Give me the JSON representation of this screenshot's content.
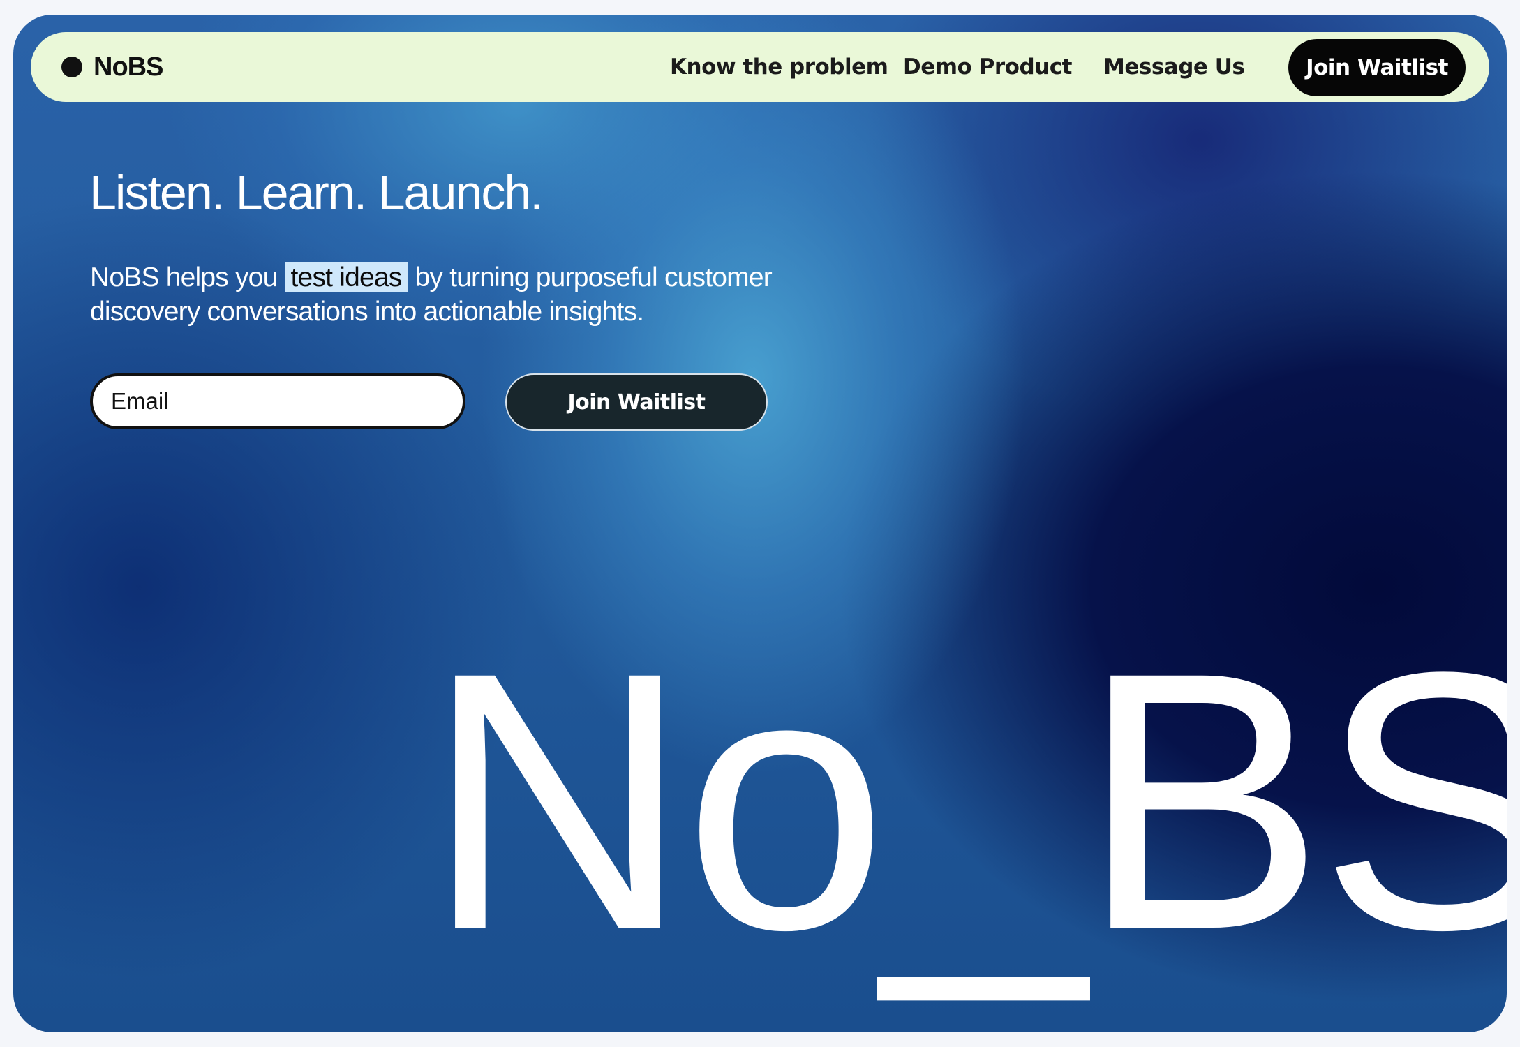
{
  "brand": {
    "name": "NoBS"
  },
  "nav": {
    "links": [
      {
        "label": "Know the problem"
      },
      {
        "label": "Demo Product"
      },
      {
        "label": "Message Us"
      }
    ],
    "cta_label": "Join Waitlist"
  },
  "hero": {
    "headline": "Listen. Learn. Launch.",
    "sub_before": "NoBS helps you ",
    "sub_highlight": "test ideas",
    "sub_after": " by turning purposeful customer discovery conversations into actionable insights.",
    "email_placeholder": "Email",
    "join_label": "Join Waitlist",
    "big_word": "No_BS"
  },
  "colors": {
    "nav_bg": "#eaf8d8",
    "cta_bg": "#060606",
    "join_bg": "#18262c",
    "highlight_bg": "#cfe8fb"
  },
  "icons": {
    "logo": "filled-circle-logo-icon"
  }
}
